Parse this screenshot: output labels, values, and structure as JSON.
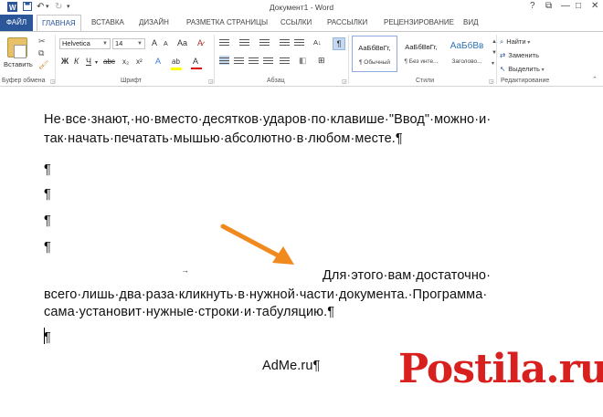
{
  "window": {
    "title": "Документ1 - Word",
    "controls": {
      "help": "?",
      "ribbon_options": "⧉",
      "minimize": "—",
      "maximize": "□",
      "close": "✕"
    }
  },
  "quick_access": {
    "save_icon": "save-icon",
    "undo_icon": "undo-icon",
    "redo_icon": "redo-icon",
    "customize": "▾"
  },
  "tabs": {
    "file": "ФАЙЛ",
    "items": [
      "ГЛАВНАЯ",
      "ВСТАВКА",
      "ДИЗАЙН",
      "РАЗМЕТКА СТРАНИЦЫ",
      "ССЫЛКИ",
      "РАССЫЛКИ",
      "РЕЦЕНЗИРОВАНИЕ",
      "ВИД"
    ],
    "active": "ГЛАВНАЯ"
  },
  "ribbon": {
    "clipboard": {
      "paste_label": "Вставить",
      "group_label": "Буфер обмена"
    },
    "font": {
      "font_name": "Helvetica",
      "font_size": "14",
      "grow": "A",
      "shrink": "A",
      "case": "Aa",
      "bold": "Ж",
      "italic": "К",
      "underline": "Ч",
      "strike": "abc",
      "subscript": "x₂",
      "superscript": "x²",
      "text_effects": "A",
      "highlight": "ab",
      "font_color": "A",
      "group_label": "Шрифт"
    },
    "paragraph": {
      "show_marks": "¶",
      "sort": "A↓",
      "group_label": "Абзац"
    },
    "styles": {
      "items": [
        {
          "sample": "АаБбВвГг,",
          "name": "¶ Обычный"
        },
        {
          "sample": "АаБбВвГг,",
          "name": "¶ Без инте..."
        },
        {
          "sample": "АаБбВв",
          "name": "Заголово..."
        }
      ],
      "group_label": "Стили"
    },
    "editing": {
      "find": "Найти",
      "replace": "Заменить",
      "select": "Выделить",
      "group_label": "Редактирование"
    }
  },
  "document": {
    "lines": [
      "Не·все·знают,·но·вместо·десятков·ударов·по·клавише·\"Ввод\"·можно·и·",
      "так·начать·печатать·мышью·абсолютно·в·любом·месте.¶",
      "¶",
      "¶",
      "¶",
      "¶",
      "Для·этого·вам·достаточно·",
      "всего·лишь·два·раза·кликнуть·в·нужной·части·документа.·Программа·",
      "сама·установит·нужные·строки·и·табуляцию.¶",
      "¶",
      "AdMe.ru¶"
    ],
    "tab_mark": "→"
  },
  "watermark": {
    "text": "Postila.ru"
  },
  "colors": {
    "accent": "#2b579a",
    "arrow": "#f08a1e",
    "watermark": "#d8211f"
  }
}
